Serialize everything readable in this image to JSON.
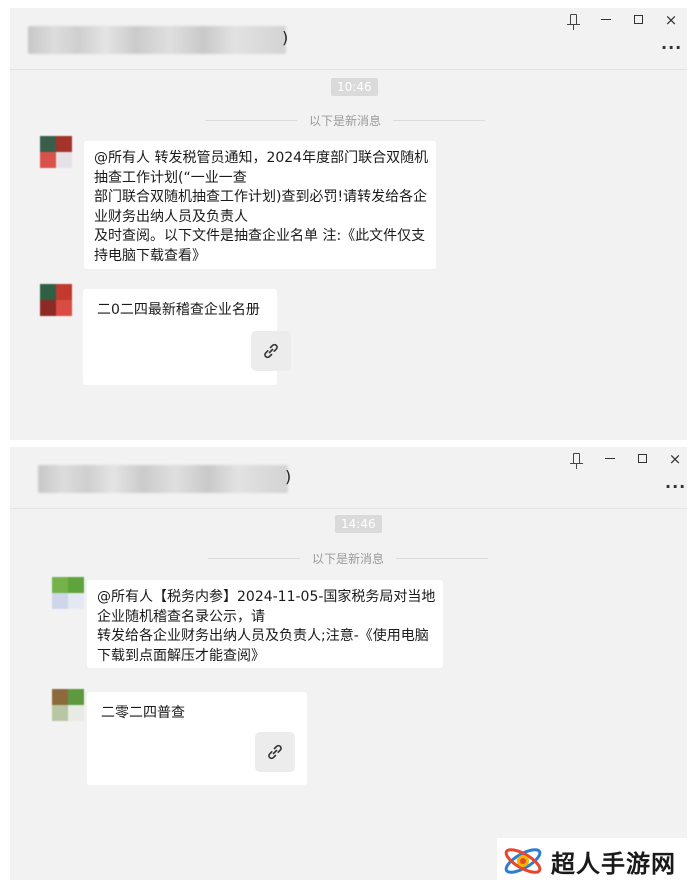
{
  "window1": {
    "title_suffix": ")",
    "time": "10:46",
    "divider_text": "以下是新消息",
    "message": {
      "lines": [
        "@所有人 转发税管员通知，2024年度部门联合双随机",
        "抽查工作计划(“一业一查",
        "部门联合双随机抽查工作计划)查到必罚!请转发给各企",
        "业财务出纳人员及负责人",
        "及时查阅。以下文件是抽查企业名单 注:《此文件仅支",
        "持电脑下载查看》"
      ]
    },
    "card_title": "二0二四最新稽查企业名册"
  },
  "window2": {
    "title_suffix": ")",
    "time": "14:46",
    "divider_text": "以下是新消息",
    "message": {
      "lines": [
        "@所有人【税务内参】2024-11-05-国家税务局对当地",
        "企业随机稽查名录公示，请",
        "转发给各企业财务出纳人员及负责人;注意-《使用电脑",
        "下载到点面解压才能查阅》"
      ]
    },
    "card_title": "二零二四普查"
  },
  "window_controls": {
    "pin": "pin-icon",
    "minimize": "minimize-icon",
    "maximize": "maximize-icon",
    "close_label": "×",
    "more_label": "···"
  },
  "watermark": {
    "text": "超人手游网"
  },
  "colors": {
    "window_bg": "#f2f2f2",
    "bubble_bg": "#ffffff",
    "time_pill": "#dadada",
    "divider_text": "#9a9a9a"
  }
}
